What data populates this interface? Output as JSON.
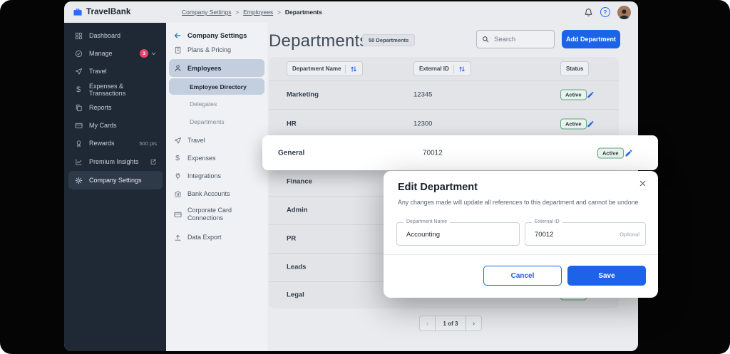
{
  "colors": {
    "accent_blue": "#1c63e8",
    "badge_red": "#e8446d",
    "active_green": "#63a683",
    "sidebar_dark": "#1f2936"
  },
  "brand": {
    "name": "TravelBank"
  },
  "breadcrumb": {
    "sep": ">",
    "items": [
      "Company Settings",
      "Employees",
      "Departments"
    ]
  },
  "sidebar": {
    "items": [
      {
        "label": "Dashboard"
      },
      {
        "label": "Manage",
        "badge": "3"
      },
      {
        "label": "Travel"
      },
      {
        "label": "Expenses & Transactions"
      },
      {
        "label": "Reports"
      },
      {
        "label": "My Cards"
      },
      {
        "label": "Rewards",
        "meta": "500 pts"
      },
      {
        "label": "Premium Insights"
      },
      {
        "label": "Company Settings"
      }
    ]
  },
  "settings_nav": {
    "back_label": "Company Settings",
    "items": [
      {
        "label": "Plans & Pricing"
      },
      {
        "label": "Employees"
      },
      {
        "label": "Employee Directory"
      },
      {
        "label": "Delegates"
      },
      {
        "label": "Departments"
      },
      {
        "label": "Travel"
      },
      {
        "label": "Expenses"
      },
      {
        "label": "Integrations"
      },
      {
        "label": "Bank Accounts"
      },
      {
        "label": "Corporate Card Connections"
      },
      {
        "label": "Data Export"
      }
    ]
  },
  "page": {
    "title": "Departments",
    "count_badge": "50 Departments",
    "search_placeholder": "Search",
    "add_button_label": "Add Department"
  },
  "table": {
    "columns": {
      "name": "Department Name",
      "external_id": "External ID",
      "status": "Status"
    },
    "rows": [
      {
        "name": "Marketing",
        "external_id": "12345",
        "status": "Active"
      },
      {
        "name": "HR",
        "external_id": "12300",
        "status": "Active"
      },
      {
        "name": "Finance"
      },
      {
        "name": "Admin"
      },
      {
        "name": "PR"
      },
      {
        "name": "Leads"
      },
      {
        "name": "Legal",
        "status": "Active"
      }
    ],
    "highlighted_row": {
      "name": "General",
      "external_id": "70012",
      "status": "Active"
    }
  },
  "pagination": {
    "label": "1 of 3",
    "prev": "‹",
    "next": "›"
  },
  "modal": {
    "title": "Edit Department",
    "description": "Any changes made will update all references to this department and cannot be undone.",
    "name_field": {
      "label": "Department Name",
      "value": "Accounting"
    },
    "id_field": {
      "label": "External ID",
      "value": "70012",
      "hint": "Optional"
    },
    "cancel_label": "Cancel",
    "save_label": "Save"
  }
}
